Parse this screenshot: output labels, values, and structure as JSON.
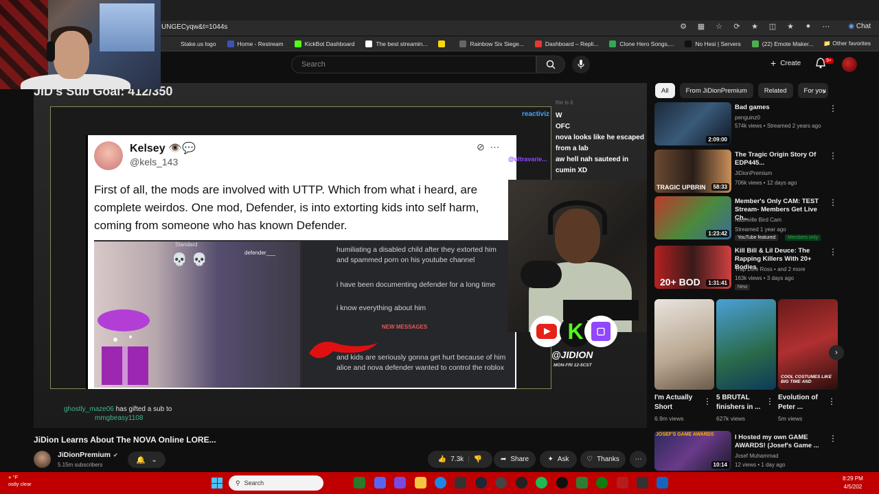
{
  "browser": {
    "url": "UNGECyqw&t=1044s",
    "chat_label": "Chat",
    "bookmarks": [
      {
        "label": "Stake.us logo",
        "color": "#2b2b2b"
      },
      {
        "label": "Home - Restream",
        "color": "#3f51b5"
      },
      {
        "label": "KickBot Dashboard",
        "color": "#53fc18"
      },
      {
        "label": "The best streamin...",
        "color": "#ffffff"
      },
      {
        "label": "",
        "color": "#f5d90a"
      },
      {
        "label": "Rainbow Six Siege...",
        "color": "#666666"
      },
      {
        "label": "Dashboard – Repli...",
        "color": "#e53935"
      },
      {
        "label": "Clone Hero Songs,...",
        "color": "#34a853"
      },
      {
        "label": "No Hesi | Servers",
        "color": "#111111"
      },
      {
        "label": "(22) Emote Maker...",
        "color": "#4caf50"
      }
    ],
    "other_favorites": "Other favorites"
  },
  "youtube": {
    "search_placeholder": "Search",
    "create_label": "Create",
    "notif_count": "9+"
  },
  "video": {
    "sub_goal": "JID's Sub Goal: 412/350",
    "tweet": {
      "name": "Kelsey 👁️💬",
      "handle": "@kels_143",
      "body": "First of all, the mods are involved with UTTP. Which from what i heard, are complete weirdos. One mod, Defender, is into extorting kids into self harm, coming from someone who has known Defender."
    },
    "dm": {
      "line1": "humiliating a disabled child after they extorted him and spammed porn on his youtube channel",
      "line2": "i have been documenting defender for a long time",
      "line3": "i know everything about him",
      "new_messages": "NEW MESSAGES",
      "line4": "and kids are seriously gonna get hurt because of him alice and nova defender wanted to control the roblox",
      "defender_tag": "defender___",
      "standard_tag": "Standard"
    },
    "chat": {
      "name1": "reactiviz",
      "name2": "@ultravarie...",
      "faded": "the is it",
      "msg_w": "W",
      "msg_ofc": "OFC",
      "msg_nova": "nova looks like he escaped from a lab",
      "msg_aw": "aw hell nah sauteed in cumin XD"
    },
    "streamer_handle": "@JIDION",
    "schedule": "MON-FRI 12-5CST",
    "gift_user": "ghostly_maze06",
    "gift_text": " has gifted a sub to",
    "gift_target": "mmgbeasy1108",
    "title": "JiDion Learns About The NOVA Online LORE...",
    "channel": "JiDionPremium",
    "subscribers": "5.15m subscribers",
    "likes": "7.3k",
    "share": "Share",
    "ask": "Ask",
    "thanks": "Thanks"
  },
  "sidebar": {
    "chips": [
      "All",
      "From JiDionPremium",
      "Related",
      "For you"
    ],
    "recs": [
      {
        "title": "Bad games",
        "channel": "penguinz0",
        "meta": "574k views • Streamed 2 years ago",
        "duration": "2:09:00"
      },
      {
        "title": "The Tragic Origin Story Of EDP445...",
        "channel": "JiDionPremium",
        "meta": "706k views • 12 days ago",
        "duration": "58:33",
        "overlay": "TRAGIC UPBRIN"
      },
      {
        "title": "Member's Only CAM: TEST Stream- Members Get Live Ch...",
        "channel": "Nashville Bird Cam",
        "meta": "Streamed 1 year ago",
        "duration": "1:23:42",
        "badge1": "YouTube featured",
        "badge2": "Members only"
      },
      {
        "title": "Kill Bill & Lil Deuce: The Rapping Killers With 20+ Bodies",
        "channel": "Trap Lore Ross • and 2 more",
        "meta": "163k views • 3 days ago",
        "duration": "1:31:41",
        "badge1": "New",
        "overlay": "20+ BOD"
      }
    ],
    "shorts": [
      {
        "title": "I'm Actually Short",
        "views": "6.9m views"
      },
      {
        "title": "5 BRUTAL finishers in ...",
        "views": "627k views"
      },
      {
        "title": "Evolution of Peter ...",
        "views": "5m views",
        "overlay": "COOL COSTUMES LIKE BIG TIME AND"
      }
    ],
    "last_rec": {
      "title": "I Hosted my own GAME AWARDS! (Josef's Game ...",
      "channel": "Josef Muhammad",
      "meta": "12 views • 1 day ago",
      "duration": "10:14",
      "overlay": "JOSEF'S GAME AWARDS"
    }
  },
  "taskbar": {
    "weather_temp": "°F",
    "weather_desc": "ostly clear",
    "search_label": "Search",
    "time": "8:29 PM",
    "date": "4/5/202"
  }
}
